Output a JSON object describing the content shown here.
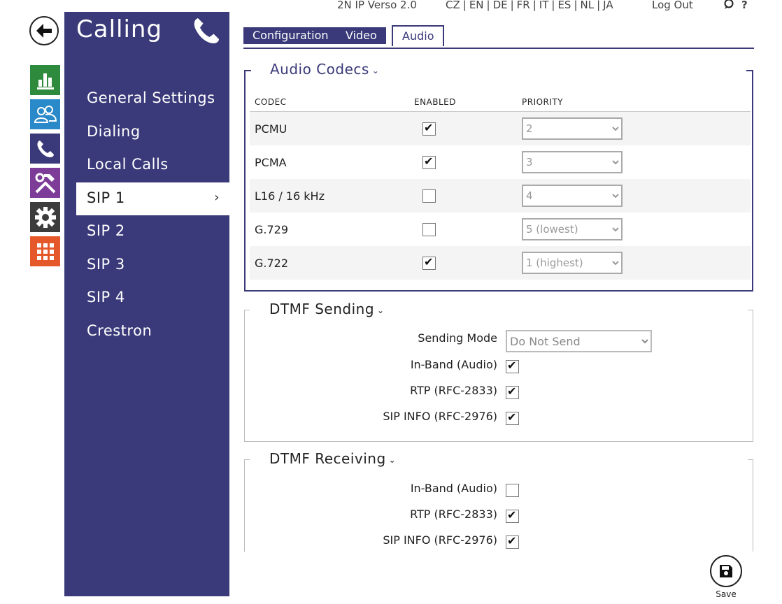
{
  "topbar": {
    "product": "2N IP Verso 2.0",
    "languages": [
      "CZ",
      "EN",
      "DE",
      "FR",
      "IT",
      "ES",
      "NL",
      "JA"
    ],
    "logout": "Log Out",
    "help": "?"
  },
  "rail": {
    "items": [
      {
        "icon": "status-chart-icon",
        "color": "#2e8b3e"
      },
      {
        "icon": "directory-users-icon",
        "color": "#2a8ac9"
      },
      {
        "icon": "calling-phone-icon",
        "color": "#3a3a7a"
      },
      {
        "icon": "hardware-tools-icon",
        "color": "#7d3c98"
      },
      {
        "icon": "system-gear-icon",
        "color": "#3c3c3c"
      },
      {
        "icon": "services-grid-icon",
        "color": "#e4582a"
      }
    ]
  },
  "nav": {
    "title": "Calling",
    "items": [
      "General Settings",
      "Dialing",
      "Local Calls",
      "SIP 1",
      "SIP 2",
      "SIP 3",
      "SIP 4",
      "Crestron"
    ],
    "active": "SIP 1",
    "active_chevron": "›"
  },
  "tabs": [
    "Configuration",
    "Video",
    "Audio"
  ],
  "active_tab": "Audio",
  "audio_codecs": {
    "title": "Audio Codecs",
    "columns": [
      "CODEC",
      "ENABLED",
      "PRIORITY"
    ],
    "rows": [
      {
        "codec": "PCMU",
        "enabled": true,
        "priority": "2"
      },
      {
        "codec": "PCMA",
        "enabled": true,
        "priority": "3"
      },
      {
        "codec": "L16 / 16 kHz",
        "enabled": false,
        "priority": "4"
      },
      {
        "codec": "G.729",
        "enabled": false,
        "priority": "5 (lowest)"
      },
      {
        "codec": "G.722",
        "enabled": true,
        "priority": "1 (highest)"
      }
    ]
  },
  "dtmf_sending": {
    "title": "DTMF Sending",
    "sending_mode_label": "Sending Mode",
    "sending_mode_value": "Do Not Send",
    "inband_label": "In-Band (Audio)",
    "inband": true,
    "rtp_label": "RTP (RFC-2833)",
    "rtp": true,
    "sipinfo_label": "SIP INFO (RFC-2976)",
    "sipinfo": true
  },
  "dtmf_receiving": {
    "title": "DTMF Receiving",
    "inband_label": "In-Band (Audio)",
    "inband": false,
    "rtp_label": "RTP (RFC-2833)",
    "rtp": true,
    "sipinfo_label": "SIP INFO (RFC-2976)",
    "sipinfo": true
  },
  "save_label": "Save"
}
